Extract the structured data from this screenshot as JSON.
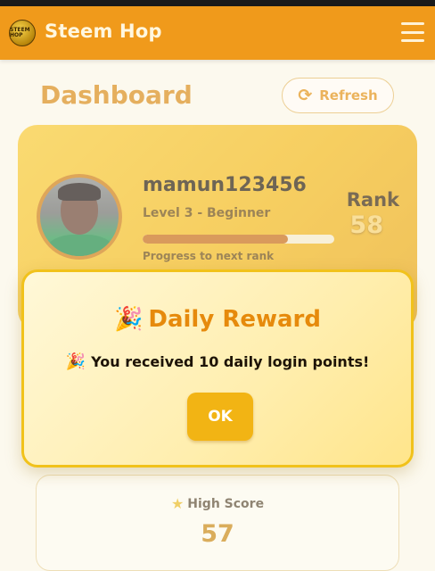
{
  "header": {
    "logo_text": "STEEM HOP",
    "title": "Steem Hop",
    "menu_icon": "hamburger-menu-icon"
  },
  "dashboard": {
    "title": "Dashboard",
    "refresh_label": "Refresh",
    "refresh_icon": "refresh-icon"
  },
  "profile": {
    "username": "mamun123456",
    "level": "Level 3 - Beginner",
    "progress_fraction": 0.76,
    "progress_label": "Progress to next rank",
    "rank_label": "Rank",
    "rank_value": "58"
  },
  "high_score": {
    "label": "High Score",
    "value": "57",
    "icon": "star-icon"
  },
  "modal": {
    "title": "Daily Reward",
    "message": "You received 10 daily login points!",
    "icon": "party-popper-icon",
    "ok_label": "OK"
  },
  "colors": {
    "header_bg": "#f09a1b",
    "accent": "#e28f10",
    "card_gold": "#f2b716",
    "modal_border": "#f1c21b",
    "ok_button": "#f2b414"
  }
}
